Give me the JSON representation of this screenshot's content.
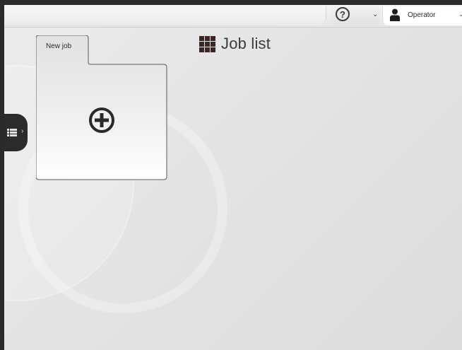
{
  "topbar": {
    "help_icon": "question-circle-icon",
    "user": {
      "icon": "person-icon",
      "label": "Operator"
    }
  },
  "page": {
    "title": "Job list",
    "title_icon": "grid-icon"
  },
  "drawer": {
    "icon": "list-icon"
  },
  "card": {
    "tab_label": "New job",
    "action_icon": "plus-circle-icon"
  },
  "colors": {
    "frame": "#2a2a2a",
    "accent_dark": "#3b2626",
    "background": "#e4e4e4"
  }
}
